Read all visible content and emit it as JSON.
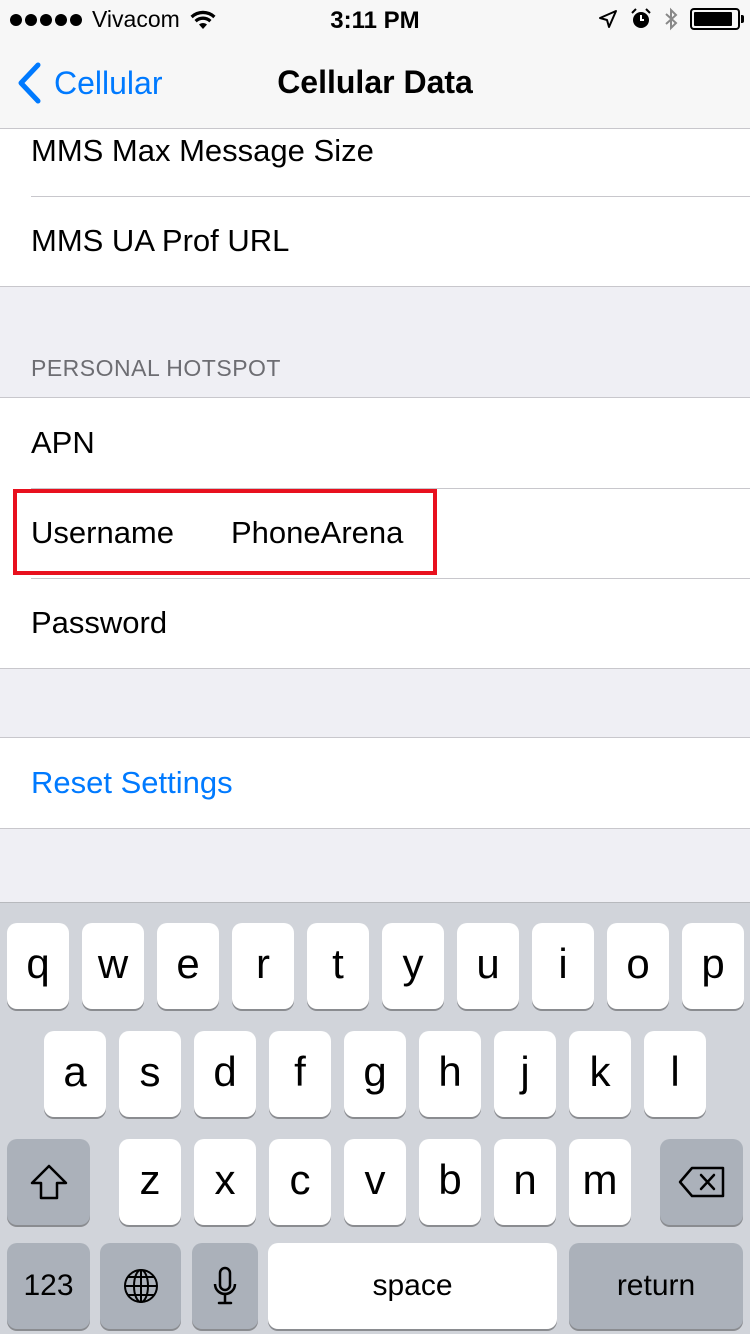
{
  "status_bar": {
    "carrier": "Vivacom",
    "time": "3:11 PM",
    "battery_level": 0.9
  },
  "nav": {
    "back_label": "Cellular",
    "title": "Cellular Data"
  },
  "mms_rows": [
    {
      "label": "MMS Max Message Size"
    },
    {
      "label": "MMS UA Prof URL"
    }
  ],
  "hotspot": {
    "header": "PERSONAL HOTSPOT",
    "apn_label": "APN",
    "username_label": "Username",
    "username_value": "PhoneArena",
    "password_label": "Password"
  },
  "reset": {
    "label": "Reset Settings"
  },
  "keyboard": {
    "row1": [
      "q",
      "w",
      "e",
      "r",
      "t",
      "y",
      "u",
      "i",
      "o",
      "p"
    ],
    "row2": [
      "a",
      "s",
      "d",
      "f",
      "g",
      "h",
      "j",
      "k",
      "l"
    ],
    "row3": [
      "z",
      "x",
      "c",
      "v",
      "b",
      "n",
      "m"
    ],
    "numbers_label": "123",
    "space_label": "space",
    "return_label": "return"
  },
  "colors": {
    "accent": "#007aff",
    "highlight": "#e8101e"
  }
}
